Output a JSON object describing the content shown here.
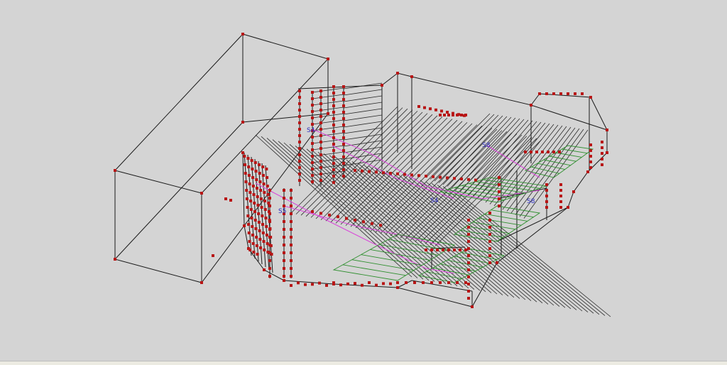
{
  "view": {
    "title": "",
    "background": "#d4d4d4",
    "status_strip_color": "#ecebe2"
  },
  "colors": {
    "wireframe": "#1a1a1a",
    "vertex": "#b81616",
    "airflow_path": "#d94bd9",
    "fuel_package": "#2f8f2f",
    "sensor_label": "#2b2bbf"
  },
  "sensor_labels": [
    "S4",
    "S5",
    "S8",
    "S4",
    "S8"
  ]
}
